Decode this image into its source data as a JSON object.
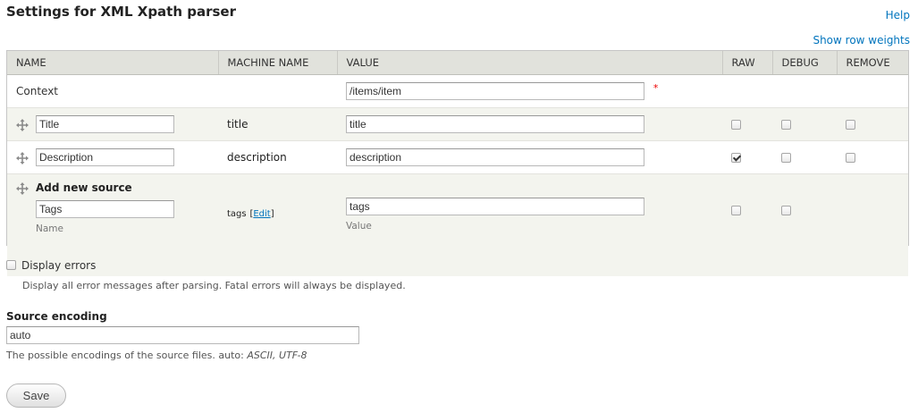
{
  "page": {
    "title": "Settings for XML Xpath parser",
    "help_link": "Help",
    "show_weights_link": "Show row weights"
  },
  "table": {
    "headers": [
      "NAME",
      "MACHINE NAME",
      "VALUE",
      "RAW",
      "DEBUG",
      "REMOVE"
    ],
    "context": {
      "label": "Context",
      "value": "/items/item",
      "required_marker": "*"
    },
    "rows": [
      {
        "name": "Title",
        "machine": "title",
        "value": "title",
        "raw": false,
        "debug": false,
        "remove": false
      },
      {
        "name": "Description",
        "machine": "description",
        "value": "description",
        "raw": true,
        "debug": false,
        "remove": false
      }
    ],
    "new_source": {
      "title": "Add new source",
      "name": "Tags",
      "machine": "tags",
      "edit_label": "[Edit]",
      "edit_link_text": "Edit",
      "value": "tags",
      "name_desc": "Name",
      "value_desc": "Value",
      "raw": false,
      "debug": false
    }
  },
  "display_errors": {
    "label": "Display errors",
    "checked": false,
    "description": "Display all error messages after parsing. Fatal errors will always be displayed."
  },
  "source_encoding": {
    "label": "Source encoding",
    "value": "auto",
    "description_prefix": "The possible encodings of the source files. auto: ",
    "description_em": "ASCII, UTF-8"
  },
  "save_label": "Save",
  "icons": {
    "drag": "move-handle-icon",
    "checkbox": "checkbox"
  },
  "colors": {
    "link": "#0074bd",
    "required": "#ee0000",
    "header_bg": "#e1e2dc",
    "row_alt": "#f3f4ee"
  }
}
